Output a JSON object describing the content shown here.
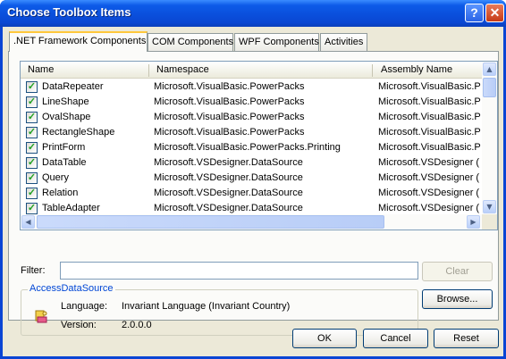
{
  "window": {
    "title": "Choose Toolbox Items",
    "help_icon": "question-mark",
    "close_icon": "x-close"
  },
  "tabs": [
    {
      "label": ".NET Framework Components",
      "active": true
    },
    {
      "label": "COM Components",
      "active": false
    },
    {
      "label": "WPF Components",
      "active": false
    },
    {
      "label": "Activities",
      "active": false
    }
  ],
  "list": {
    "columns": [
      "Name",
      "Namespace",
      "Assembly Name"
    ],
    "rows": [
      {
        "checked": true,
        "name": "DataRepeater",
        "namespace": "Microsoft.VisualBasic.PowerPacks",
        "assembly": "Microsoft.VisualBasic.P"
      },
      {
        "checked": true,
        "name": "LineShape",
        "namespace": "Microsoft.VisualBasic.PowerPacks",
        "assembly": "Microsoft.VisualBasic.P"
      },
      {
        "checked": true,
        "name": "OvalShape",
        "namespace": "Microsoft.VisualBasic.PowerPacks",
        "assembly": "Microsoft.VisualBasic.P"
      },
      {
        "checked": true,
        "name": "RectangleShape",
        "namespace": "Microsoft.VisualBasic.PowerPacks",
        "assembly": "Microsoft.VisualBasic.P"
      },
      {
        "checked": true,
        "name": "PrintForm",
        "namespace": "Microsoft.VisualBasic.PowerPacks.Printing",
        "assembly": "Microsoft.VisualBasic.P"
      },
      {
        "checked": true,
        "name": "DataTable",
        "namespace": "Microsoft.VSDesigner.DataSource",
        "assembly": "Microsoft.VSDesigner ("
      },
      {
        "checked": true,
        "name": "Query",
        "namespace": "Microsoft.VSDesigner.DataSource",
        "assembly": "Microsoft.VSDesigner ("
      },
      {
        "checked": true,
        "name": "Relation",
        "namespace": "Microsoft.VSDesigner.DataSource",
        "assembly": "Microsoft.VSDesigner ("
      },
      {
        "checked": true,
        "name": "TableAdapter",
        "namespace": "Microsoft.VSDesigner.DataSource",
        "assembly": "Microsoft.VSDesigner ("
      }
    ]
  },
  "filter": {
    "label": "Filter:",
    "value": "",
    "clear_label": "Clear"
  },
  "details": {
    "group_title": "AccessDataSource",
    "language_label": "Language:",
    "language_value": "Invariant Language (Invariant Country)",
    "version_label": "Version:",
    "version_value": "2.0.0.0",
    "icon": "component-icon"
  },
  "buttons": {
    "browse": "Browse...",
    "ok": "OK",
    "cancel": "Cancel",
    "reset": "Reset"
  },
  "colors": {
    "title_bar": "#0a4fdc",
    "dialog_bg": "#ece9d8",
    "group_title": "#0046d5",
    "check": "#21a121"
  }
}
